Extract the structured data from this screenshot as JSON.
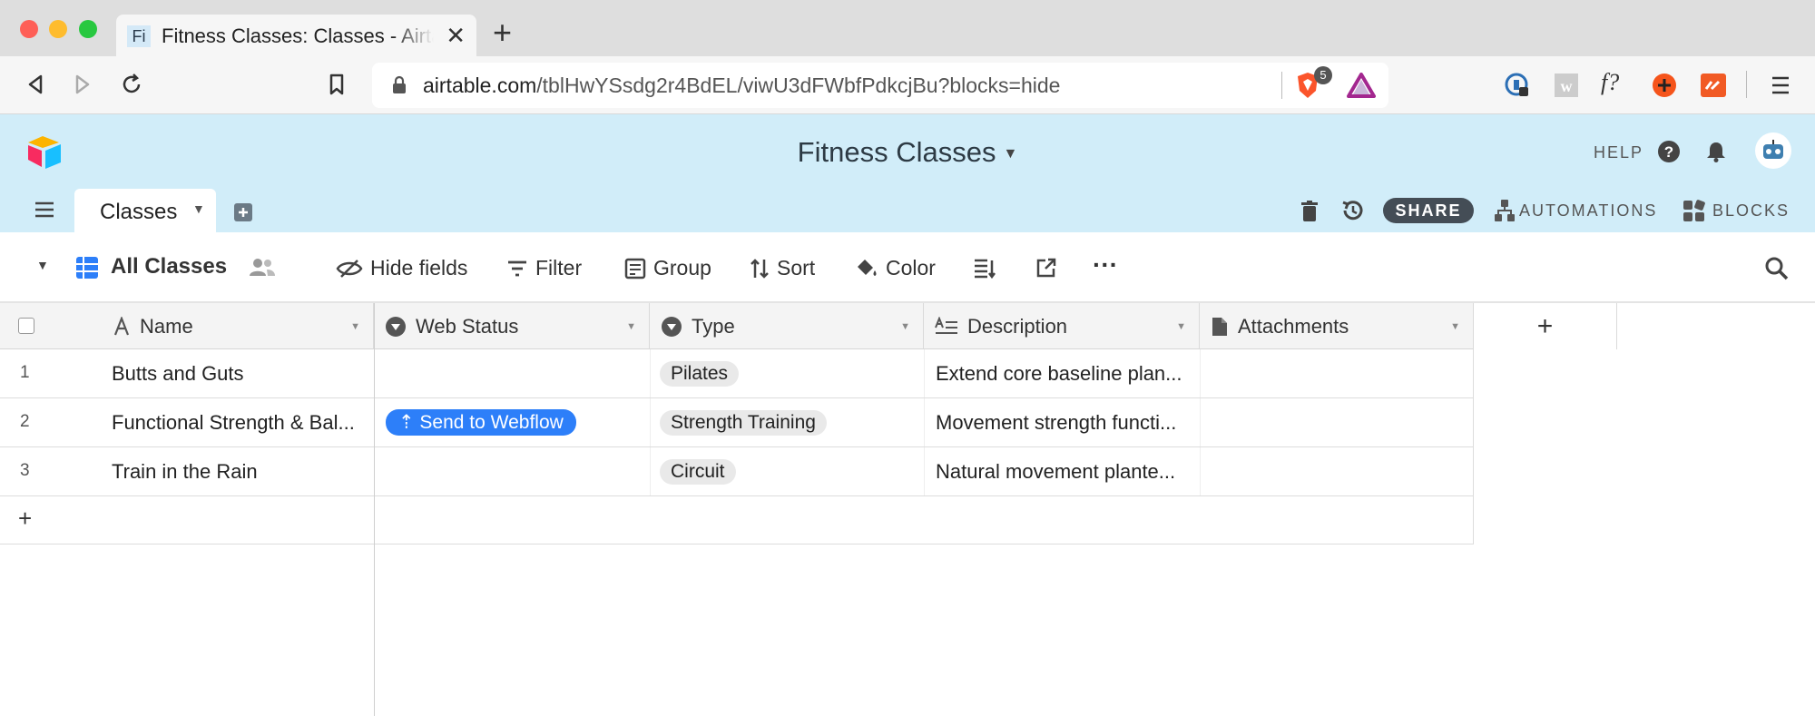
{
  "browser": {
    "tab_favicon_text": "Fi",
    "tab_title": "Fitness Classes: Classes - Airtable",
    "url_host": "airtable.com",
    "url_path": "/tblHwYSsdg2r4BdEL/viwU3dFWbfPdkcjBu?blocks=hide",
    "shields_count": "5",
    "ext_fx_label": "f?"
  },
  "header": {
    "base_title": "Fitness Classes",
    "help_label": "HELP",
    "table_tab_label": "Classes",
    "share_label": "SHARE",
    "automations_label": "AUTOMATIONS",
    "blocks_label": "BLOCKS",
    "background_color": "#d1edf9"
  },
  "viewbar": {
    "view_name": "All Classes",
    "hide_fields": "Hide fields",
    "filter": "Filter",
    "group": "Group",
    "sort": "Sort",
    "color": "Color",
    "more": "···"
  },
  "grid": {
    "columns": [
      {
        "label": "Name",
        "icon": "text-icon"
      },
      {
        "label": "Web Status",
        "icon": "single-select-icon"
      },
      {
        "label": "Type",
        "icon": "single-select-icon"
      },
      {
        "label": "Description",
        "icon": "long-text-icon"
      },
      {
        "label": "Attachments",
        "icon": "attachment-icon"
      }
    ],
    "add_column_label": "+",
    "rows": [
      {
        "num": "1",
        "name": "Butts and Guts",
        "web_status": "",
        "type": "Pilates",
        "description": "Extend core baseline plan..."
      },
      {
        "num": "2",
        "name": "Functional Strength & Bal...",
        "web_status": "⇡ Send to Webflow",
        "type": "Strength Training",
        "description": "Movement strength functi..."
      },
      {
        "num": "3",
        "name": "Train in the Rain",
        "web_status": "",
        "type": "Circuit",
        "description": "Natural movement plante..."
      }
    ],
    "add_row_label": "+",
    "accent_button_color": "#2d7ff9"
  }
}
